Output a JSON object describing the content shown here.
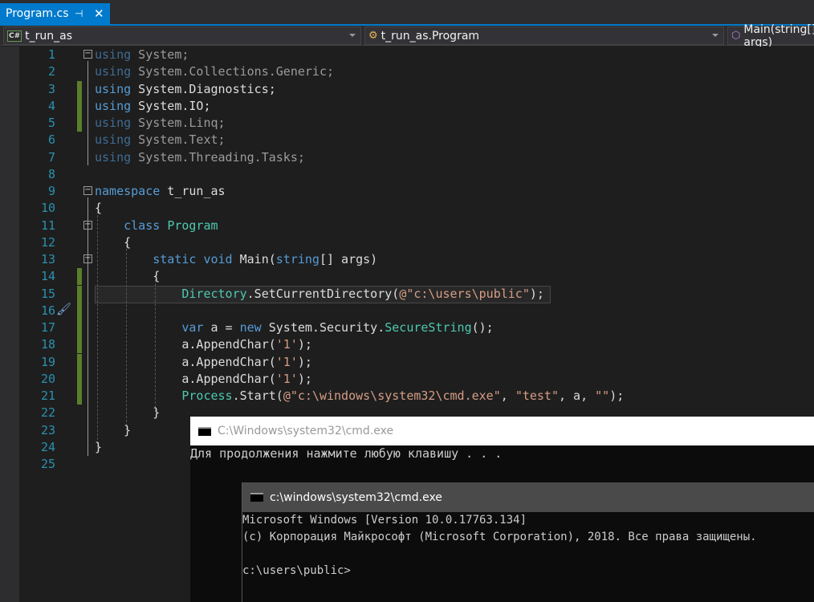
{
  "tab": {
    "title": "Program.cs",
    "pin": "⊣",
    "close": "✕"
  },
  "nav": {
    "project": "t_run_as",
    "class": "t_run_as.Program",
    "member": "Main(string[] args)",
    "cs_badge": "C#"
  },
  "colors": {
    "accent": "#007acc",
    "keyword": "#569cd6",
    "type": "#4ec9b0",
    "string": "#d69d85",
    "line_number": "#2b91af",
    "change_bar": "#5b7e2c"
  },
  "editor": {
    "lines": [
      {
        "n": "1",
        "t": [
          [
            "dkw",
            "using"
          ],
          [
            "dim",
            " System;"
          ]
        ],
        "chg": false
      },
      {
        "n": "2",
        "t": [
          [
            "dkw",
            "using"
          ],
          [
            "dim",
            " System.Collections.Generic;"
          ]
        ],
        "chg": false
      },
      {
        "n": "3",
        "t": [
          [
            "kw",
            "using"
          ],
          [
            "",
            " System.Diagnostics;"
          ]
        ],
        "chg": true
      },
      {
        "n": "4",
        "t": [
          [
            "kw",
            "using"
          ],
          [
            "",
            " System.IO;"
          ]
        ],
        "chg": true
      },
      {
        "n": "5",
        "t": [
          [
            "dkw",
            "using"
          ],
          [
            "dim",
            " System.Linq;"
          ]
        ],
        "chg": true
      },
      {
        "n": "6",
        "t": [
          [
            "dkw",
            "using"
          ],
          [
            "dim",
            " System.Text;"
          ]
        ],
        "chg": false
      },
      {
        "n": "7",
        "t": [
          [
            "dkw",
            "using"
          ],
          [
            "dim",
            " System.Threading.Tasks;"
          ]
        ],
        "chg": false
      },
      {
        "n": "8",
        "t": [],
        "chg": false
      },
      {
        "n": "9",
        "t": [
          [
            "kw",
            "namespace"
          ],
          [
            "",
            " t_run_as"
          ]
        ],
        "chg": false
      },
      {
        "n": "10",
        "t": [
          [
            "",
            "{"
          ]
        ],
        "chg": false
      },
      {
        "n": "11",
        "t": [
          [
            "",
            "    "
          ],
          [
            "kw",
            "class"
          ],
          [
            "",
            " "
          ],
          [
            "ty",
            "Program"
          ]
        ],
        "chg": false
      },
      {
        "n": "12",
        "t": [
          [
            "",
            "    {"
          ]
        ],
        "chg": false
      },
      {
        "n": "13",
        "t": [
          [
            "",
            "        "
          ],
          [
            "kw",
            "static"
          ],
          [
            "",
            " "
          ],
          [
            "kw",
            "void"
          ],
          [
            "",
            " Main("
          ],
          [
            "kw",
            "string"
          ],
          [
            "",
            "[] args)"
          ]
        ],
        "chg": false
      },
      {
        "n": "14",
        "t": [
          [
            "",
            "        {"
          ]
        ],
        "chg": true
      },
      {
        "n": "15",
        "t": [
          [
            "",
            "            "
          ],
          [
            "ty",
            "Directory"
          ],
          [
            "",
            ".SetCurrentDirectory("
          ],
          [
            "st",
            "@\"c:\\users\\public\""
          ],
          [
            "",
            ");"
          ]
        ],
        "chg": true
      },
      {
        "n": "16",
        "t": [],
        "chg": true
      },
      {
        "n": "17",
        "t": [
          [
            "",
            "            "
          ],
          [
            "kw",
            "var"
          ],
          [
            "",
            " a = "
          ],
          [
            "kw",
            "new"
          ],
          [
            "",
            " System.Security."
          ],
          [
            "ty",
            "SecureString"
          ],
          [
            "",
            "();"
          ]
        ],
        "chg": true
      },
      {
        "n": "18",
        "t": [
          [
            "",
            "            a.AppendChar("
          ],
          [
            "st",
            "'1'"
          ],
          [
            "",
            ");"
          ]
        ],
        "chg": true
      },
      {
        "n": "19",
        "t": [
          [
            "",
            "            a.AppendChar("
          ],
          [
            "st",
            "'1'"
          ],
          [
            "",
            ");"
          ]
        ],
        "chg": true
      },
      {
        "n": "20",
        "t": [
          [
            "",
            "            a.AppendChar("
          ],
          [
            "st",
            "'1'"
          ],
          [
            "",
            ");"
          ]
        ],
        "chg": true
      },
      {
        "n": "21",
        "t": [
          [
            "",
            "            "
          ],
          [
            "ty",
            "Process"
          ],
          [
            "",
            ".Start("
          ],
          [
            "st",
            "@\"c:\\windows\\system32\\cmd.exe\""
          ],
          [
            "",
            ", "
          ],
          [
            "st",
            "\"test\""
          ],
          [
            "",
            ", a, "
          ],
          [
            "st",
            "\"\""
          ],
          [
            "",
            ");"
          ]
        ],
        "chg": true
      },
      {
        "n": "22",
        "t": [
          [
            "",
            "        }"
          ]
        ],
        "chg": false
      },
      {
        "n": "23",
        "t": [
          [
            "",
            "    }"
          ]
        ],
        "chg": false
      },
      {
        "n": "24",
        "t": [
          [
            "",
            "}"
          ]
        ],
        "chg": false
      },
      {
        "n": "25",
        "t": [],
        "chg": false
      }
    ],
    "collapsible": [
      "1",
      "9",
      "11",
      "13"
    ],
    "quick_action_icon": "screwdriver-brush-icon"
  },
  "cmd1": {
    "title": "C:\\Windows\\system32\\cmd.exe",
    "text": "Для продолжения нажмите любую клавишу . . ."
  },
  "cmd2": {
    "title": "c:\\windows\\system32\\cmd.exe",
    "lines": [
      "Microsoft Windows [Version 10.0.17763.134]",
      "(c) Корпорация Майкрософт (Microsoft Corporation), 2018. Все права защищены.",
      "",
      "c:\\users\\public>"
    ]
  }
}
